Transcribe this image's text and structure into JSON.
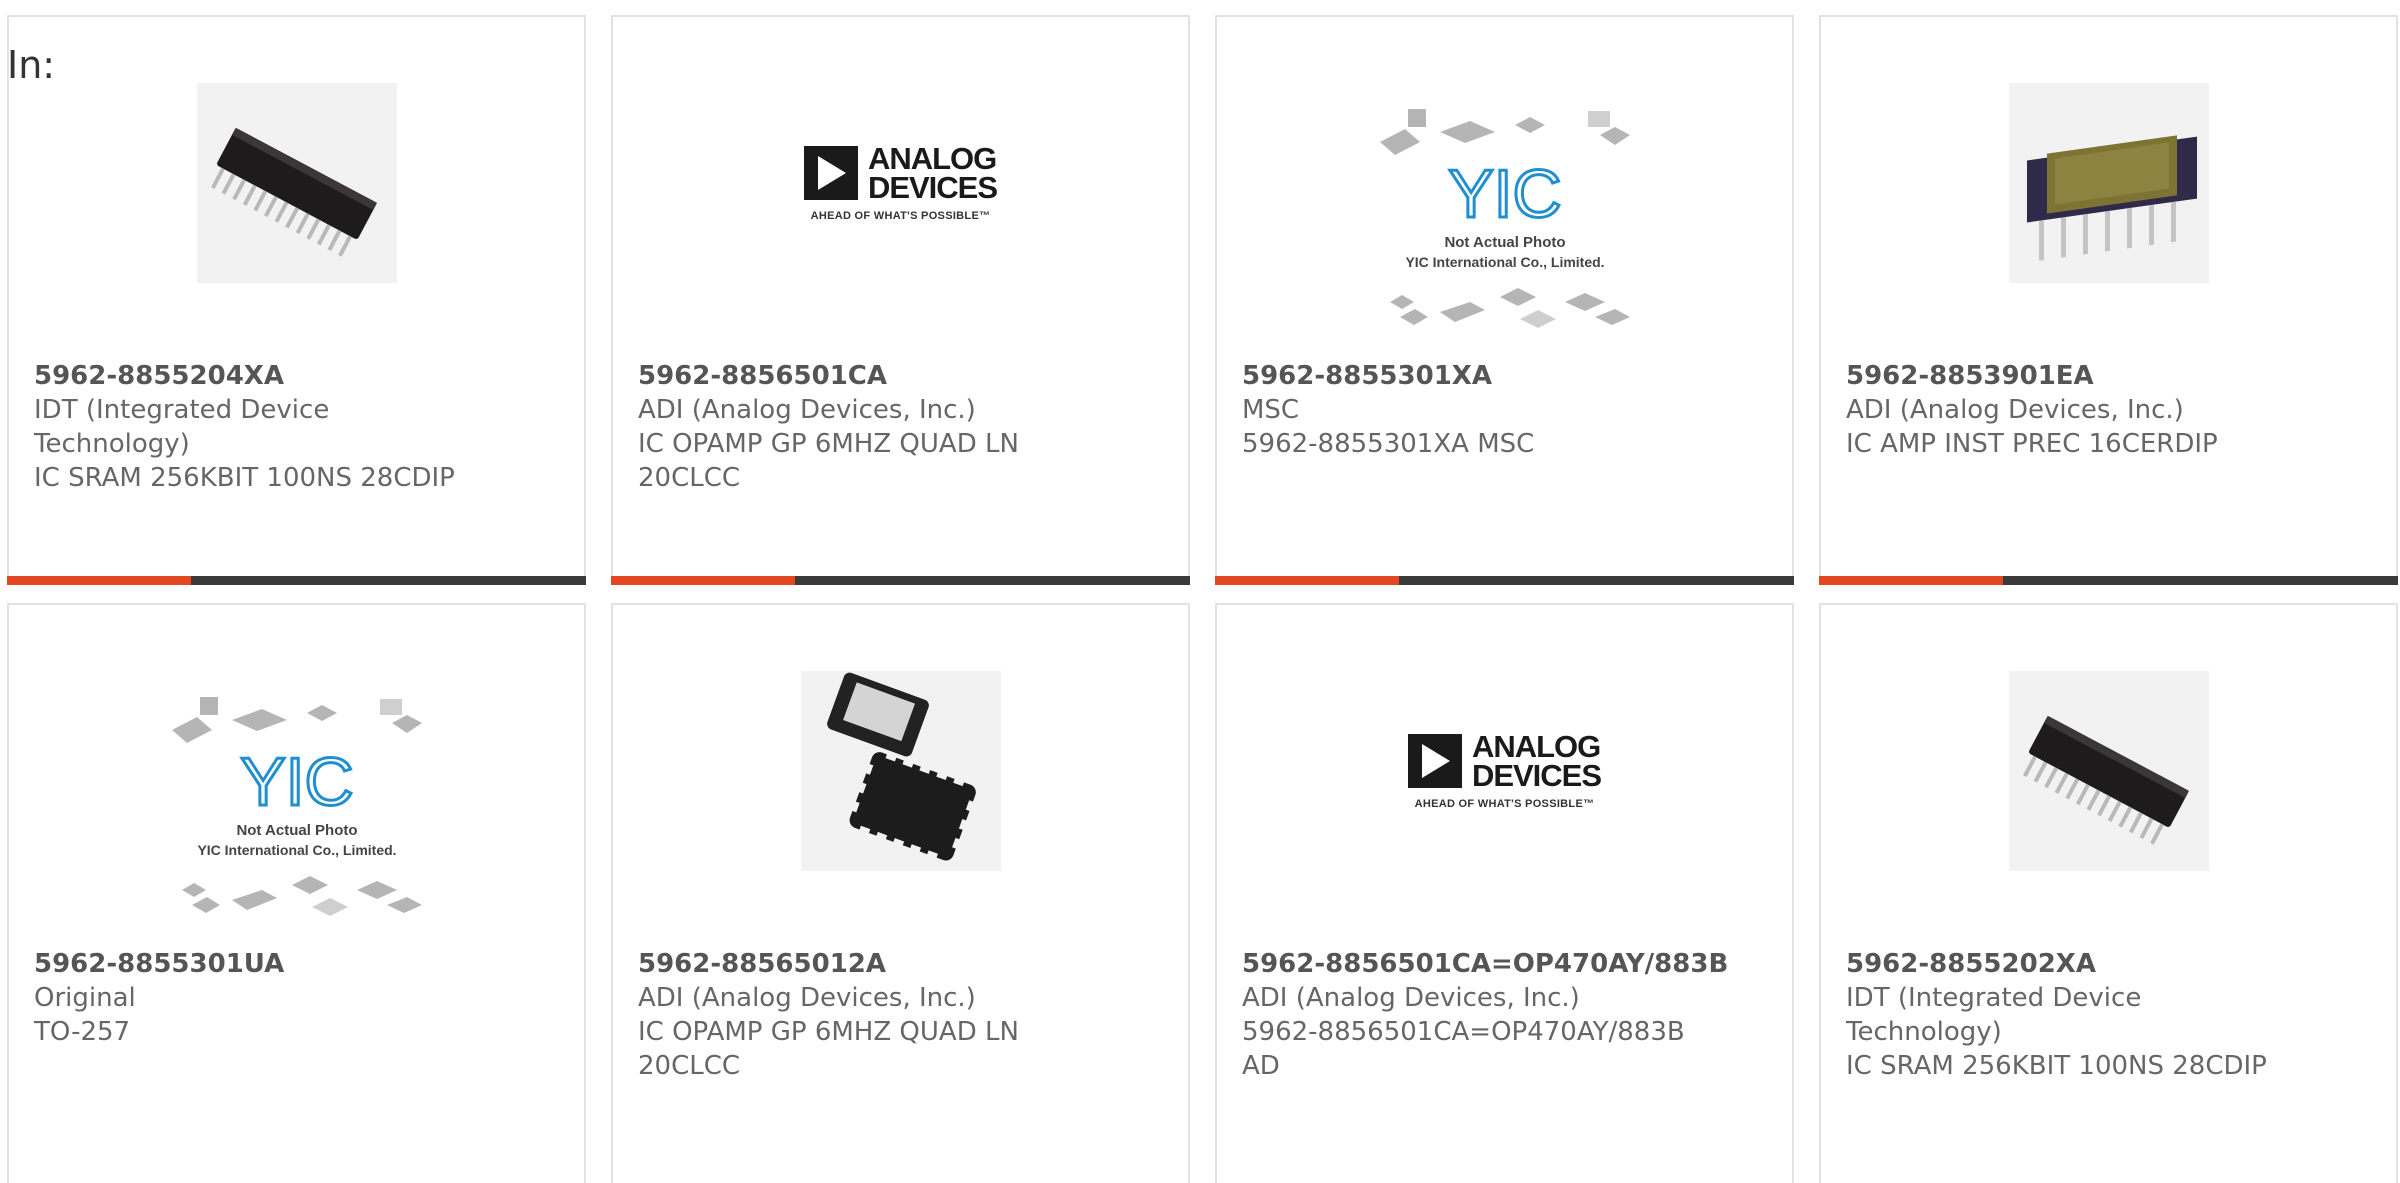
{
  "page": {
    "filter_label": "In:"
  },
  "accent_color": "#e2471f",
  "products": [
    {
      "part_number": "5962-8855204XA",
      "manufacturer_lines": [
        "IDT (Integrated Device",
        "Technology)"
      ],
      "description_lines": [
        "IC SRAM 256KBIT 100NS 28CDIP"
      ],
      "image": "dip-28-chip-photo"
    },
    {
      "part_number": "5962-8856501CA",
      "manufacturer_lines": [
        "ADI (Analog Devices, Inc.)"
      ],
      "description_lines": [
        "IC OPAMP GP 6MHZ QUAD LN",
        "20CLCC"
      ],
      "image": "analog-devices-logo"
    },
    {
      "part_number": "5962-8855301XA",
      "manufacturer_lines": [
        "MSC"
      ],
      "description_lines": [
        "5962-8855301XA MSC"
      ],
      "image": "yic-not-actual-photo"
    },
    {
      "part_number": "5962-8853901EA",
      "manufacturer_lines": [
        "ADI (Analog Devices, Inc.)"
      ],
      "description_lines": [
        "IC AMP INST PREC 16CERDIP"
      ],
      "image": "cerdip-16-chip-photo"
    },
    {
      "part_number": "5962-8855301UA",
      "manufacturer_lines": [
        "Original"
      ],
      "description_lines": [
        "TO-257"
      ],
      "image": "yic-not-actual-photo"
    },
    {
      "part_number": "5962-88565012A",
      "manufacturer_lines": [
        "ADI (Analog Devices, Inc.)"
      ],
      "description_lines": [
        "IC OPAMP GP 6MHZ QUAD LN",
        "20CLCC"
      ],
      "image": "lcc-20-chip-photo"
    },
    {
      "part_number": "5962-8856501CA=OP470AY/883B",
      "manufacturer_lines": [
        "ADI (Analog Devices, Inc.)"
      ],
      "description_lines": [
        "5962-8856501CA=OP470AY/883B",
        "AD"
      ],
      "image": "analog-devices-logo"
    },
    {
      "part_number": "5962-8855202XA",
      "manufacturer_lines": [
        "IDT (Integrated Device",
        "Technology)"
      ],
      "description_lines": [
        "IC SRAM 256KBIT 100NS 28CDIP"
      ],
      "image": "dip-28-chip-photo"
    }
  ],
  "logos": {
    "analog_devices": {
      "line1": "ANALOG",
      "line2": "DEVICES",
      "tagline": "AHEAD OF WHAT'S POSSIBLE™"
    },
    "yic": {
      "mark": "YIC",
      "line1": "Not Actual Photo",
      "line2": "YIC International Co., Limited."
    }
  }
}
